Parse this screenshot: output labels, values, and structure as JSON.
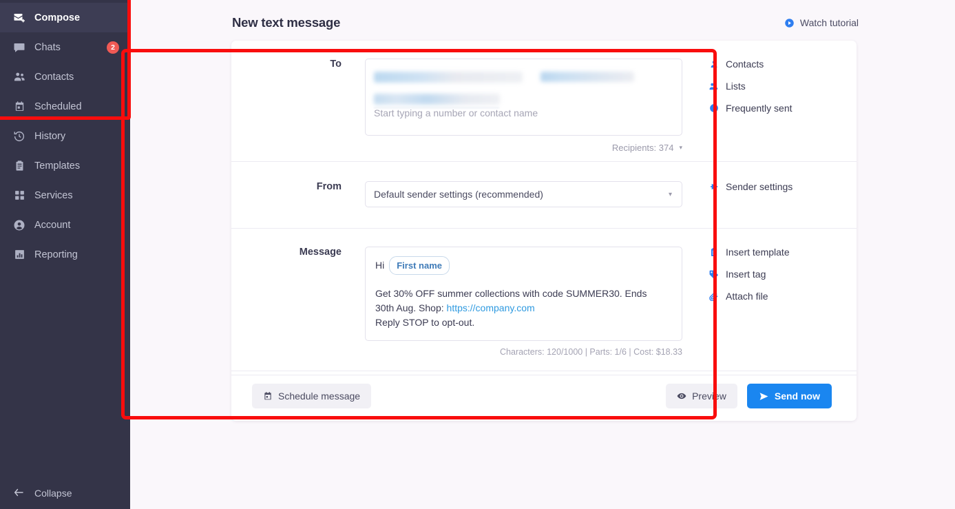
{
  "sidebar": {
    "items": [
      {
        "label": "Compose",
        "icon": "compose-icon",
        "active": true,
        "badge": ""
      },
      {
        "label": "Chats",
        "icon": "chats-icon",
        "active": false,
        "badge": "2"
      },
      {
        "label": "Contacts",
        "icon": "contacts-icon",
        "active": false,
        "badge": ""
      },
      {
        "label": "Scheduled",
        "icon": "scheduled-icon",
        "active": false,
        "badge": ""
      },
      {
        "label": "History",
        "icon": "history-icon",
        "active": false,
        "badge": ""
      },
      {
        "label": "Templates",
        "icon": "templates-icon",
        "active": false,
        "badge": ""
      },
      {
        "label": "Services",
        "icon": "services-icon",
        "active": false,
        "badge": ""
      },
      {
        "label": "Account",
        "icon": "account-icon",
        "active": false,
        "badge": ""
      },
      {
        "label": "Reporting",
        "icon": "reporting-icon",
        "active": false,
        "badge": ""
      }
    ],
    "collapse_label": "Collapse",
    "collapse_icon": "collapse-arrow-icon",
    "bg_color": "#343448",
    "active_bg_color": "#3d3d54",
    "badge_color": "#f05a55"
  },
  "header": {
    "title": "New text message",
    "watch_tutorial_label": "Watch tutorial",
    "watch_tutorial_icon": "play-circle-icon"
  },
  "highlight": {
    "color": "#f90d0d"
  },
  "compose": {
    "to": {
      "label": "To",
      "placeholder": "Start typing a number or contact name",
      "recipients_text": "Recipients: 374",
      "recipients_count": 374,
      "caret": "▾",
      "side_links": [
        {
          "label": "Contacts",
          "icon": "person-icon"
        },
        {
          "label": "Lists",
          "icon": "people-icon"
        },
        {
          "label": "Frequently sent",
          "icon": "clock-icon"
        }
      ]
    },
    "from": {
      "label": "From",
      "value": "Default sender settings (recommended)",
      "caret": "▾",
      "side_links": [
        {
          "label": "Sender settings",
          "icon": "gear-icon"
        }
      ]
    },
    "message": {
      "label": "Message",
      "greeting": "Hi",
      "tag": "First name",
      "body_line1": "Get 30% OFF summer collections with code SUMMER30. Ends",
      "body_line2_prefix": "30th Aug. Shop: ",
      "body_link": "https://company.com",
      "body_line3": "Reply STOP to opt-out.",
      "meta": "Characters: 120/1000  |  Parts: 1/6  |  Cost: $18.33",
      "characters": "120/1000",
      "parts": "1/6",
      "cost": "$18.33",
      "side_links": [
        {
          "label": "Insert template",
          "icon": "clipboard-icon"
        },
        {
          "label": "Insert tag",
          "icon": "tag-icon"
        },
        {
          "label": "Attach file",
          "icon": "paperclip-icon"
        }
      ]
    },
    "footer": {
      "schedule_label": "Schedule message",
      "schedule_icon": "calendar-icon",
      "preview_label": "Preview",
      "preview_icon": "eye-icon",
      "send_label": "Send now",
      "send_icon": "send-icon",
      "send_color": "#1a86f0"
    }
  }
}
